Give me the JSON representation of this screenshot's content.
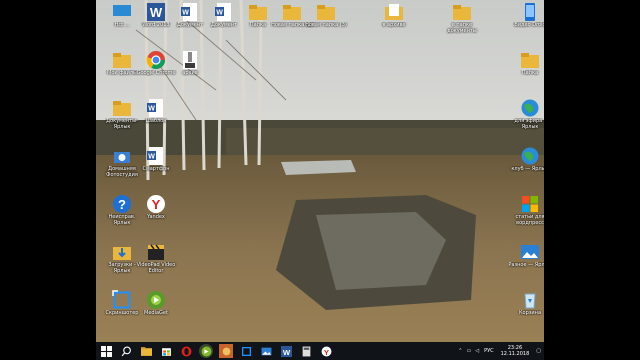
{
  "desktop_icons": [
    {
      "label": "Hct ...",
      "icon": "monitor-icon",
      "col": 0,
      "row": 0
    },
    {
      "label": "Word 2013",
      "icon": "word-icon",
      "col": 1,
      "row": 0
    },
    {
      "label": "Документ",
      "icon": "word-doc-icon",
      "col": 2,
      "row": 0
    },
    {
      "label": "Документ",
      "icon": "word-doc-icon",
      "col": 3,
      "row": 0
    },
    {
      "label": "Папка",
      "icon": "folder-icon",
      "col": 4,
      "row": 0
    },
    {
      "label": "Новая папка (2)",
      "icon": "folder-icon",
      "col": 5,
      "row": 0
    },
    {
      "label": "Новая папка (3)",
      "icon": "folder-icon",
      "col": 6,
      "row": 0
    },
    {
      "label": "в архиве",
      "icon": "folder-doc-icon",
      "col": 8,
      "row": 0
    },
    {
      "label": "в папке документы",
      "icon": "folder-icon",
      "col": 10,
      "row": 0
    },
    {
      "label": "Видео Droid",
      "icon": "phone-icon",
      "col": 12,
      "row": 0
    },
    {
      "label": "Мои файлы",
      "icon": "folder-icon",
      "col": 0,
      "row": 1
    },
    {
      "label": "Google Chrome",
      "icon": "chrome-icon",
      "col": 1,
      "row": 1
    },
    {
      "label": "архив",
      "icon": "archive-icon",
      "col": 2,
      "row": 1
    },
    {
      "label": "Папка",
      "icon": "folder-icon",
      "col": 12,
      "row": 1
    },
    {
      "label": "Документы-Ярлык",
      "icon": "folder-icon",
      "col": 0,
      "row": 2
    },
    {
      "label": "Шаблон",
      "icon": "word-doc-icon",
      "col": 1,
      "row": 2
    },
    {
      "label": "для эфира - Ярлык",
      "icon": "globe-icon",
      "col": 12,
      "row": 2
    },
    {
      "label": "Домашняя Фотостудия",
      "icon": "camera-icon",
      "col": 0,
      "row": 3
    },
    {
      "label": "Смартфон",
      "icon": "word-doc-icon",
      "col": 1,
      "row": 3
    },
    {
      "label": "клуб — Ярлык",
      "icon": "globe-icon",
      "col": 12,
      "row": 3
    },
    {
      "label": "Неисправ. Ярлык",
      "icon": "help-icon",
      "col": 0,
      "row": 4
    },
    {
      "label": "Yandex",
      "icon": "yandex-icon",
      "col": 1,
      "row": 4
    },
    {
      "label": "статьи для вордпресс",
      "icon": "windows-shield-icon",
      "col": 12,
      "row": 4
    },
    {
      "label": "Загрузки - Ярлык",
      "icon": "folder-download-icon",
      "col": 0,
      "row": 5
    },
    {
      "label": "VideoPad Video Editor",
      "icon": "clapper-icon",
      "col": 1,
      "row": 5
    },
    {
      "label": "Разное — Ярлык",
      "icon": "image-icon",
      "col": 12,
      "row": 5
    },
    {
      "label": "Скриншотер",
      "icon": "screenshot-icon",
      "col": 0,
      "row": 6
    },
    {
      "label": "MediaGet",
      "icon": "mediaget-icon",
      "col": 1,
      "row": 6
    },
    {
      "label": "Корзина",
      "icon": "recycle-bin-icon",
      "col": 12,
      "row": 6
    }
  ],
  "taskbar": {
    "apps": [
      "start-icon",
      "search-icon",
      "explorer-icon",
      "store-icon",
      "opera-icon",
      "mediaget-icon",
      "paint-icon",
      "screenshot-icon",
      "photos-icon",
      "word-icon",
      "calculator-icon",
      "yandex-icon"
    ],
    "language": "РУС",
    "time": "23:26",
    "date": "12.11.2018"
  },
  "colors": {
    "taskbar": "#101418",
    "word_blue": "#2b579a",
    "folder_yellow": "#e8b73b"
  }
}
